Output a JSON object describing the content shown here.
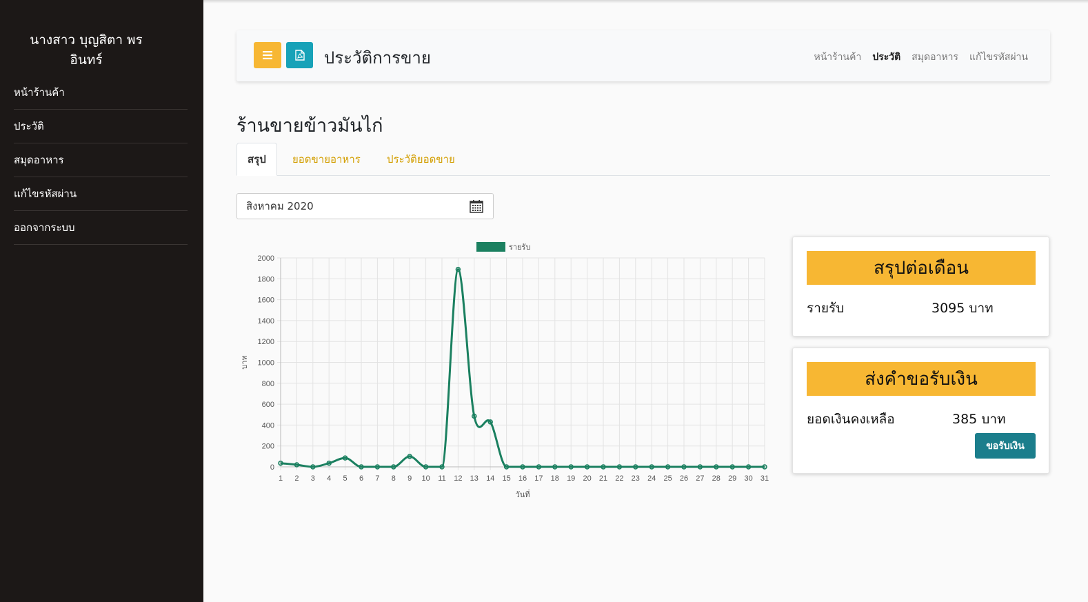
{
  "sidebar": {
    "user_name_line1": "นางสาว บุญสิตา พร",
    "user_name_line2": "อินทร์",
    "items": [
      {
        "label": "หน้าร้านค้า"
      },
      {
        "label": "ประวัติ"
      },
      {
        "label": "สมุดอาหาร"
      },
      {
        "label": "แก้ไขรหัสผ่าน"
      },
      {
        "label": "ออกจากระบบ"
      }
    ]
  },
  "header": {
    "title": "ประวัติการขาย",
    "nav": [
      {
        "label": "หน้าร้านค้า",
        "active": false
      },
      {
        "label": "ประวัติ",
        "active": true
      },
      {
        "label": "สมุดอาหาร",
        "active": false
      },
      {
        "label": "แก้ไขรหัสผ่าน",
        "active": false
      }
    ],
    "menu_icon": "hamburger-icon",
    "pdf_icon": "pdf-file-icon"
  },
  "shop_title": "ร้านขายข้าวมันไก่",
  "tabs": [
    {
      "label": "สรุป",
      "active": true
    },
    {
      "label": "ยอดขายอาหาร",
      "active": false
    },
    {
      "label": "ประวัติยอดขาย",
      "active": false
    }
  ],
  "date_picker": {
    "value": "สิงหาคม 2020",
    "icon": "calendar-icon"
  },
  "chart_data": {
    "type": "line",
    "title": "",
    "xlabel": "วันที่",
    "ylabel": "บาท",
    "x": [
      1,
      2,
      3,
      4,
      5,
      6,
      7,
      8,
      9,
      10,
      11,
      12,
      13,
      14,
      15,
      16,
      17,
      18,
      19,
      20,
      21,
      22,
      23,
      24,
      25,
      26,
      27,
      28,
      29,
      30,
      31
    ],
    "series": [
      {
        "name": "รายรับ",
        "color": "#1b8060",
        "values": [
          35,
          20,
          0,
          35,
          85,
          0,
          0,
          0,
          100,
          0,
          0,
          1890,
          485,
          430,
          0,
          0,
          0,
          0,
          0,
          0,
          0,
          0,
          0,
          0,
          0,
          0,
          0,
          0,
          0,
          0,
          0
        ]
      }
    ],
    "ylim": [
      0,
      2000
    ],
    "yticks": [
      0,
      200,
      400,
      600,
      800,
      1000,
      1200,
      1400,
      1600,
      1800,
      2000
    ],
    "grid": true,
    "legend": "top"
  },
  "summary_card": {
    "title": "สรุปต่อเดือน",
    "label": "รายรับ",
    "value": "3095 บาท"
  },
  "withdraw_card": {
    "title": "ส่งคำขอรับเงิน",
    "label": "ยอดเงินคงเหลือ",
    "value": "385 บาท",
    "button": "ขอรับเงิน"
  },
  "colors": {
    "sidebar_bg": "#1c1817",
    "accent_yellow": "#f7b733",
    "accent_teal": "#17a2b8",
    "button_teal": "#1b7e8c",
    "line_green": "#1b8060",
    "tab_link": "#d39e00"
  }
}
